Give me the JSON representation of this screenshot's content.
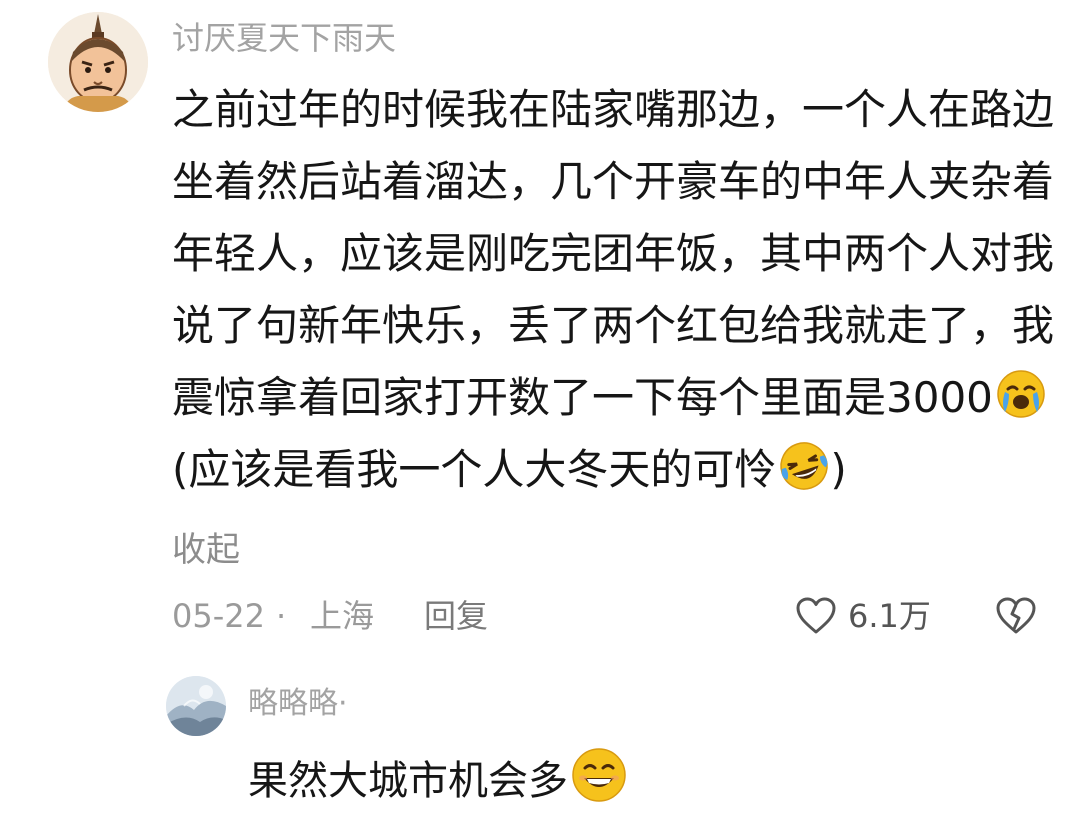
{
  "comment": {
    "username": "讨厌夏天下雨天",
    "avatar": "cartoon-man-avatar-icon",
    "lines": [
      "之前过年的时候我在陆家嘴那边，一个人在路边",
      "坐着然后站着溜达，几个开豪车的中年人夹杂着",
      "年轻人，应该是刚吃完团年饭，其中两个人对我",
      "说了句新年快乐，丢了两个红包给我就走了，我",
      "震惊拿着回家打开数了一下每个里面是3000",
      "(应该是看我一个人大冬天的可怜",
      ")"
    ],
    "emoji_1": "crying-face-icon",
    "emoji_2": "laughing-tears-face-icon",
    "collapse_label": "收起",
    "date": "05-22",
    "separator": "·",
    "location": "上海",
    "reply_label": "回复",
    "like_count": "6.1万",
    "like_icon": "heart-icon",
    "dislike_icon": "broken-heart-icon"
  },
  "reply": {
    "username": "略略略·",
    "avatar": "misty-landscape-avatar-icon",
    "text": "果然大城市机会多",
    "emoji": "grinning-face-icon"
  },
  "colors": {
    "text_primary": "#161616",
    "text_secondary": "#a3a3a3",
    "emoji_yellow": "#f6c21c",
    "emoji_blue": "#4aa3ea",
    "background": "#ffffff"
  }
}
